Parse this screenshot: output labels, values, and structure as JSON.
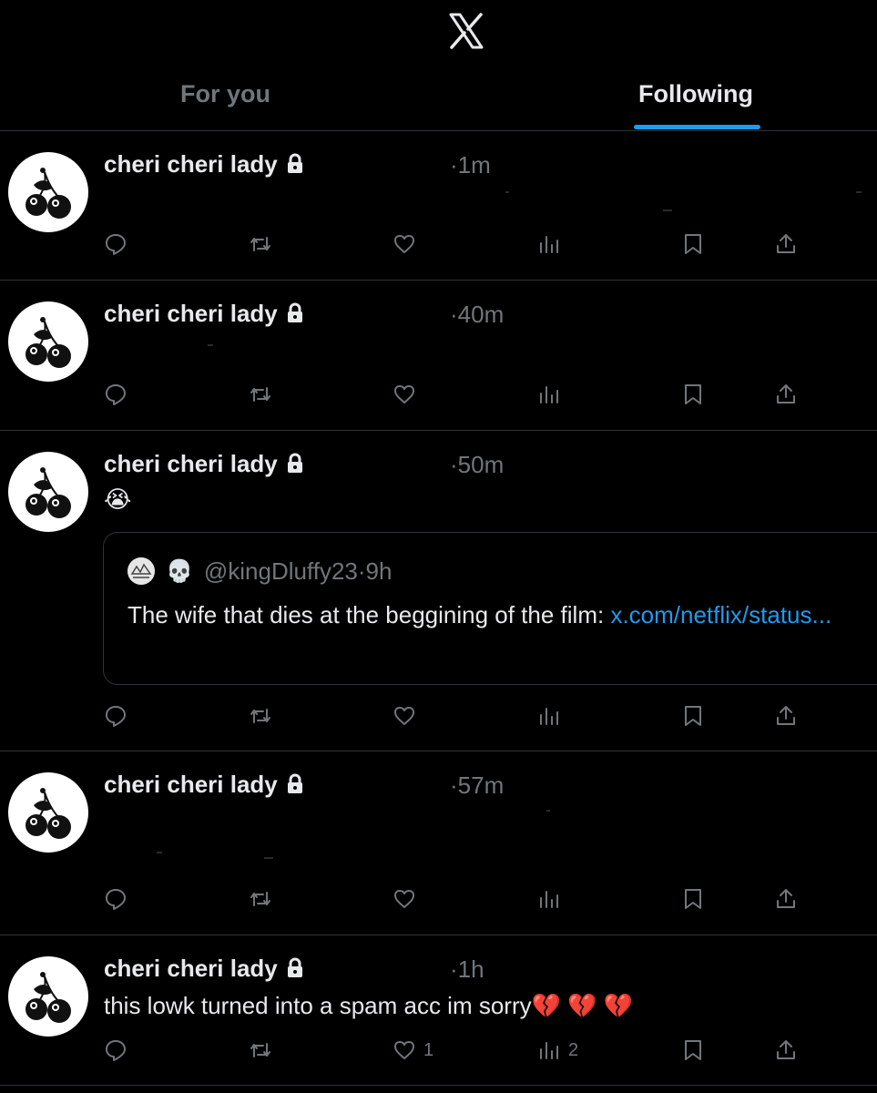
{
  "header": {
    "logo_icon": "x-logo-icon",
    "tabs": [
      {
        "label": "For you",
        "active": false
      },
      {
        "label": "Following",
        "active": true
      }
    ],
    "accent": "#1d9bf0"
  },
  "posts": [
    {
      "name": "cheri cheri lady",
      "time": "·1m",
      "text": "",
      "stats": {
        "replies": "",
        "reposts": "",
        "likes": "",
        "views": ""
      }
    },
    {
      "name": "cheri cheri lady",
      "time": "·40m",
      "text": "",
      "stats": {
        "replies": "",
        "reposts": "",
        "likes": "",
        "views": ""
      }
    },
    {
      "name": "cheri cheri lady",
      "time": "·50m",
      "text": "😭",
      "quote": {
        "emoji": "💀",
        "handle": "@kingDluffy23",
        "time": "·9h",
        "text": "The wife that dies at the beggining of the film: ",
        "link": "x.com/netflix/status..."
      },
      "stats": {
        "replies": "",
        "reposts": "",
        "likes": "",
        "views": ""
      }
    },
    {
      "name": "cheri cheri lady",
      "time": "·57m",
      "text": "",
      "stats": {
        "replies": "",
        "reposts": "",
        "likes": "",
        "views": ""
      }
    },
    {
      "name": "cheri cheri lady",
      "time": "·1h",
      "text": "this lowk turned into a spam acc im sorry💔 💔 💔",
      "stats": {
        "replies": "",
        "reposts": "",
        "likes": "1",
        "views": "2"
      }
    }
  ],
  "icons": {
    "avatar": "cherry-avatar-icon",
    "lock": "lock-icon",
    "reply": "reply-icon",
    "repost": "repost-icon",
    "like": "heart-icon",
    "views": "views-icon",
    "bookmark": "bookmark-icon",
    "share": "share-icon"
  }
}
